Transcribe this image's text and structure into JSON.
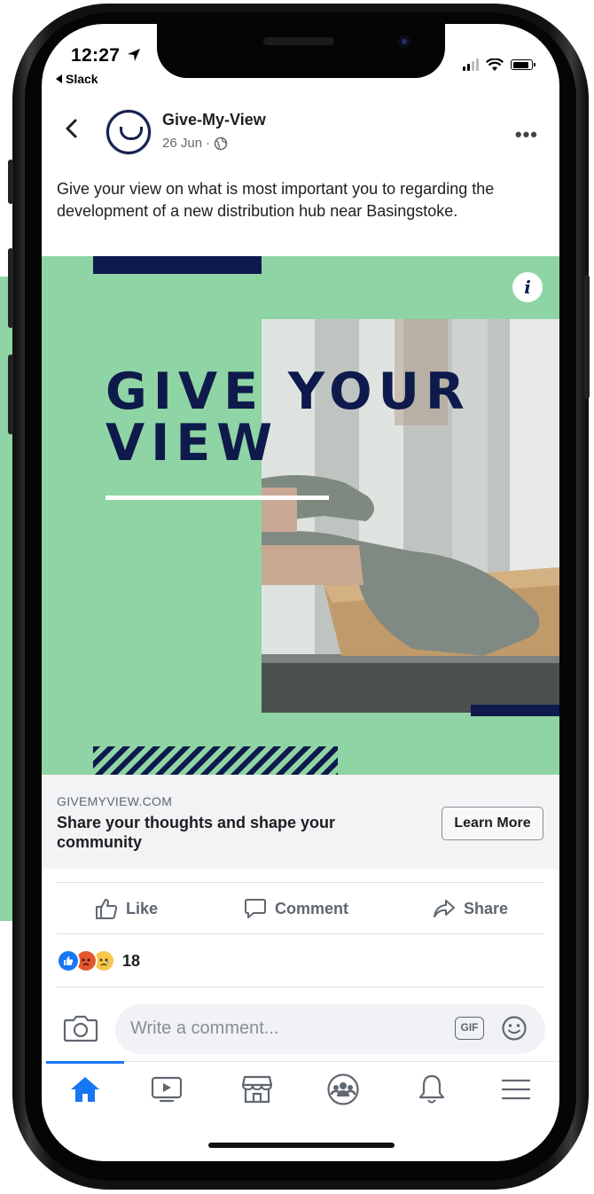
{
  "status_bar": {
    "time": "12:27",
    "back_app": "Slack"
  },
  "post": {
    "page_name": "Give-My-View",
    "date": "26 Jun",
    "separator": "·",
    "caption": "Give your view on what is most important you to regarding the development of a new distribution hub near Basingstoke.",
    "more_label": "•••"
  },
  "creative": {
    "headline": "GIVE YOUR\nVIEW",
    "info_label": "i",
    "colors": {
      "background": "#8fd4a4",
      "navy": "#0e1a4b"
    }
  },
  "link_preview": {
    "domain": "GIVEMYVIEW.COM",
    "title": "Share your thoughts and shape your community",
    "cta_label": "Learn More"
  },
  "actions": {
    "like_label": "Like",
    "comment_label": "Comment",
    "share_label": "Share"
  },
  "reactions": {
    "types": [
      "like-icon",
      "angry-icon",
      "sad-icon"
    ],
    "count": "18"
  },
  "comment_box": {
    "placeholder": "Write a comment...",
    "gif_label": "GIF"
  },
  "tab_bar": {
    "active_tab": "home",
    "tabs": [
      "home",
      "watch",
      "marketplace",
      "groups",
      "notifications",
      "menu"
    ],
    "accent_color": "#1877f2"
  }
}
